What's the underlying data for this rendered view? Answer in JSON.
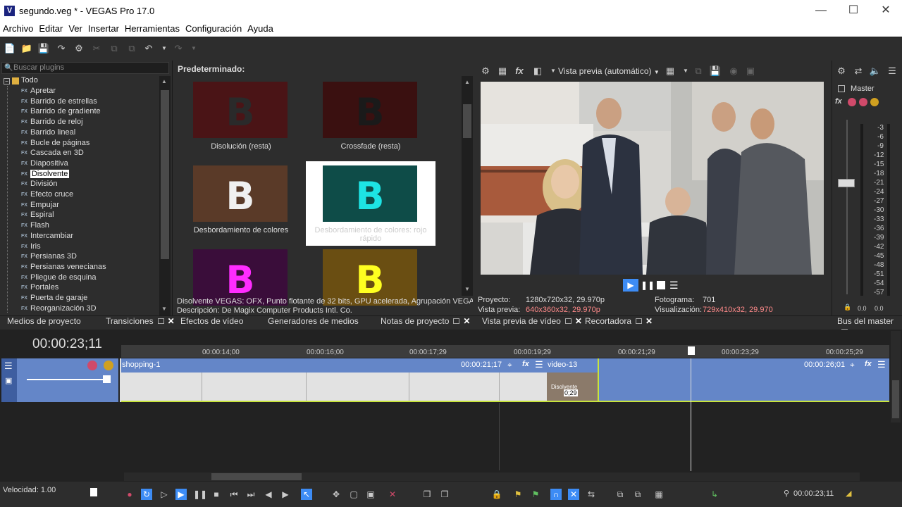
{
  "window": {
    "title": "segundo.veg * - VEGAS Pro 17.0",
    "logo": "V"
  },
  "menu": [
    "Archivo",
    "Editar",
    "Ver",
    "Insertar",
    "Herramientas",
    "Configuración",
    "Ayuda"
  ],
  "plugin_browser": {
    "search_placeholder": "Buscar plugins",
    "root": "Todo",
    "fx_badge": "FX",
    "items": [
      {
        "label": "Apretar"
      },
      {
        "label": "Barrido de estrellas"
      },
      {
        "label": "Barrido de gradiente"
      },
      {
        "label": "Barrido de reloj"
      },
      {
        "label": "Barrido lineal"
      },
      {
        "label": "Bucle de páginas"
      },
      {
        "label": "Cascada en 3D"
      },
      {
        "label": "Diapositiva"
      },
      {
        "label": "Disolvente",
        "selected": true
      },
      {
        "label": "División"
      },
      {
        "label": "Efecto cruce"
      },
      {
        "label": "Empujar"
      },
      {
        "label": "Espiral"
      },
      {
        "label": "Flash"
      },
      {
        "label": "Intercambiar"
      },
      {
        "label": "Iris"
      },
      {
        "label": "Persianas 3D"
      },
      {
        "label": "Persianas venecianas"
      },
      {
        "label": "Pliegue de esquina"
      },
      {
        "label": "Portales"
      },
      {
        "label": "Puerta de garaje"
      },
      {
        "label": "Reorganización 3D"
      }
    ]
  },
  "presets": {
    "header": "Predeterminado:",
    "glyph": "B",
    "tiles": [
      {
        "label": "Disolución (resta)",
        "bg": "#4a1416",
        "fg": "#2a2a2a"
      },
      {
        "label": "Crossfade (resta)",
        "bg": "#3a1010",
        "fg": "#1a1a1a"
      },
      {
        "label": "Desbordamiento de colores",
        "bg": "#5a3a28",
        "fg": "#f0f0f0"
      },
      {
        "label": "Desbordamiento de colores: rojo rápido",
        "bg": "#0e4c48",
        "fg": "#1de4e4",
        "selected": true
      },
      {
        "label": "",
        "bg": "#3a0d3a",
        "fg": "#ff2cff"
      },
      {
        "label": "",
        "bg": "#6a4e12",
        "fg": "#ffff20"
      }
    ],
    "desc_line1": "Disolvente VEGAS: OFX, Punto flotante de 32 bits, GPU acelerada, Agrupación VEGAS, V",
    "desc_line2": "Descripción: De Magix Computer Products Intl. Co."
  },
  "preview": {
    "mode": "Vista previa (automático)",
    "project_label": "Proyecto:",
    "project_value": "1280x720x32, 29.970p",
    "preview_label": "Vista previa:",
    "preview_value": "640x360x32, 29.970p",
    "frame_label": "Fotograma:",
    "frame_value": "701",
    "display_label": "Visualización:",
    "display_value": "729x410x32, 29.970"
  },
  "master": {
    "title": "Master",
    "ticks": [
      "3",
      "6",
      "9",
      "12",
      "15",
      "18",
      "21",
      "24",
      "27",
      "30",
      "33",
      "36",
      "39",
      "42",
      "45",
      "48",
      "51",
      "54",
      "57"
    ],
    "left_val": "0.0",
    "right_val": "0.0"
  },
  "tabs": [
    {
      "label": "Medios de proyecto"
    },
    {
      "label": "Transiciones",
      "active": true
    },
    {
      "label": "Efectos de vídeo"
    },
    {
      "label": "Generadores de medios"
    },
    {
      "label": "Notas de proyecto"
    },
    {
      "label": "Vista previa de vídeo"
    },
    {
      "label": "Recortadora"
    },
    {
      "label": "Bus del master"
    }
  ],
  "timeline": {
    "timecode": "00:00:23;11",
    "ruler": [
      "00:00:14;00",
      "00:00:16;00",
      "00:00:17;29",
      "00:00:19;29",
      "00:00:21;29",
      "00:00:23;29",
      "00:00:25;29"
    ],
    "clip1_name": "shopping-1",
    "clip1_end": "00:00:21;17",
    "clip2_name": "video-13",
    "clip2_end": "00:00:26;01",
    "transition_label": "Disolvente",
    "transition_len": "0;29"
  },
  "status": {
    "rate_label": "Velocidad: 1.00",
    "time": "00:00:23;11"
  }
}
